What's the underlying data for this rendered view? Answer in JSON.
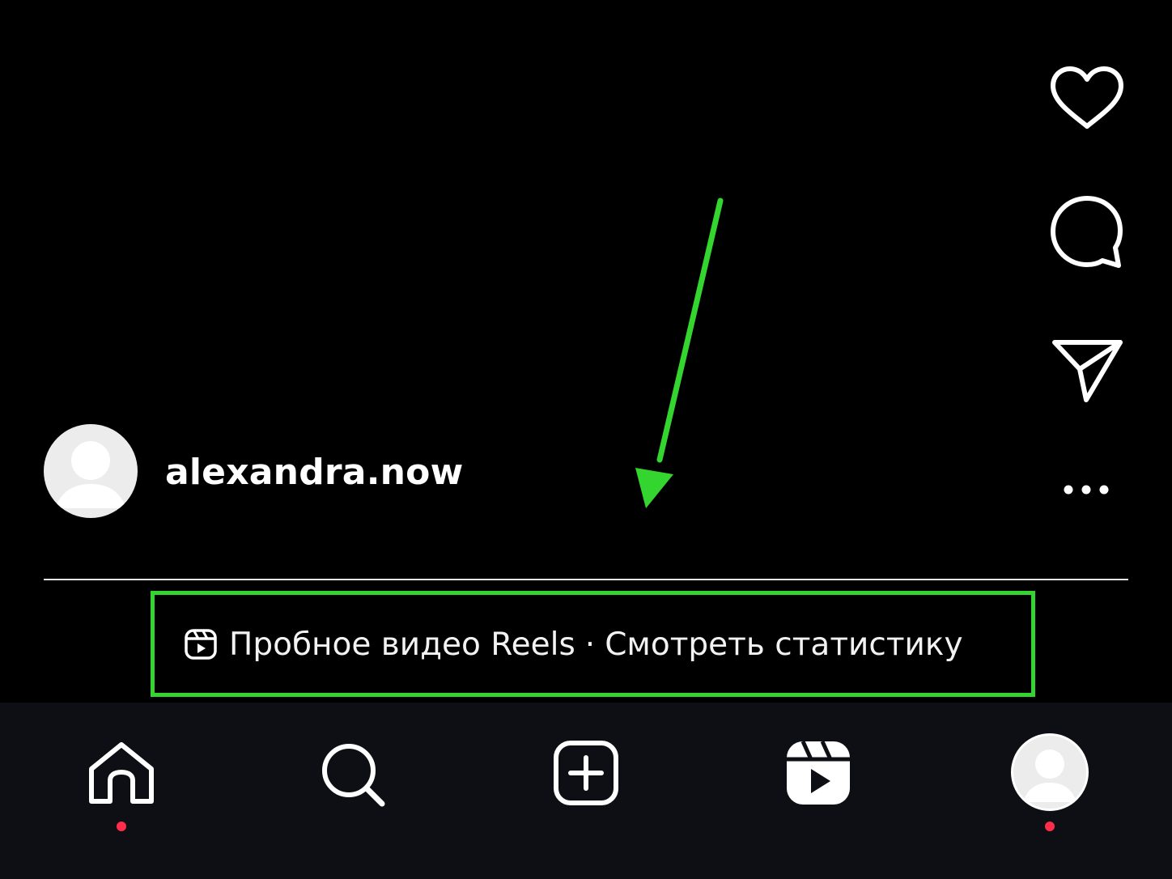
{
  "post": {
    "username": "alexandra.now"
  },
  "actions": {
    "like_icon": "heart-icon",
    "comment_icon": "comment-icon",
    "share_icon": "paper-plane-icon",
    "more_label": "..."
  },
  "trial_banner": {
    "icon": "reels-icon",
    "label": "Пробное видео Reels",
    "separator": "·",
    "link": "Смотреть статистику"
  },
  "nav": {
    "items": [
      {
        "name": "home",
        "icon": "home-icon",
        "notification": true
      },
      {
        "name": "search",
        "icon": "search-icon",
        "notification": false
      },
      {
        "name": "create",
        "icon": "plus-square-icon",
        "notification": false
      },
      {
        "name": "reels",
        "icon": "reels-icon",
        "notification": false
      },
      {
        "name": "profile",
        "icon": "avatar",
        "notification": true
      }
    ]
  },
  "colors": {
    "background": "#000000",
    "nav_background": "#0d0f14",
    "highlight": "#34d52e",
    "notification_dot": "#ff2d4a",
    "avatar_fill": "#ececec"
  }
}
